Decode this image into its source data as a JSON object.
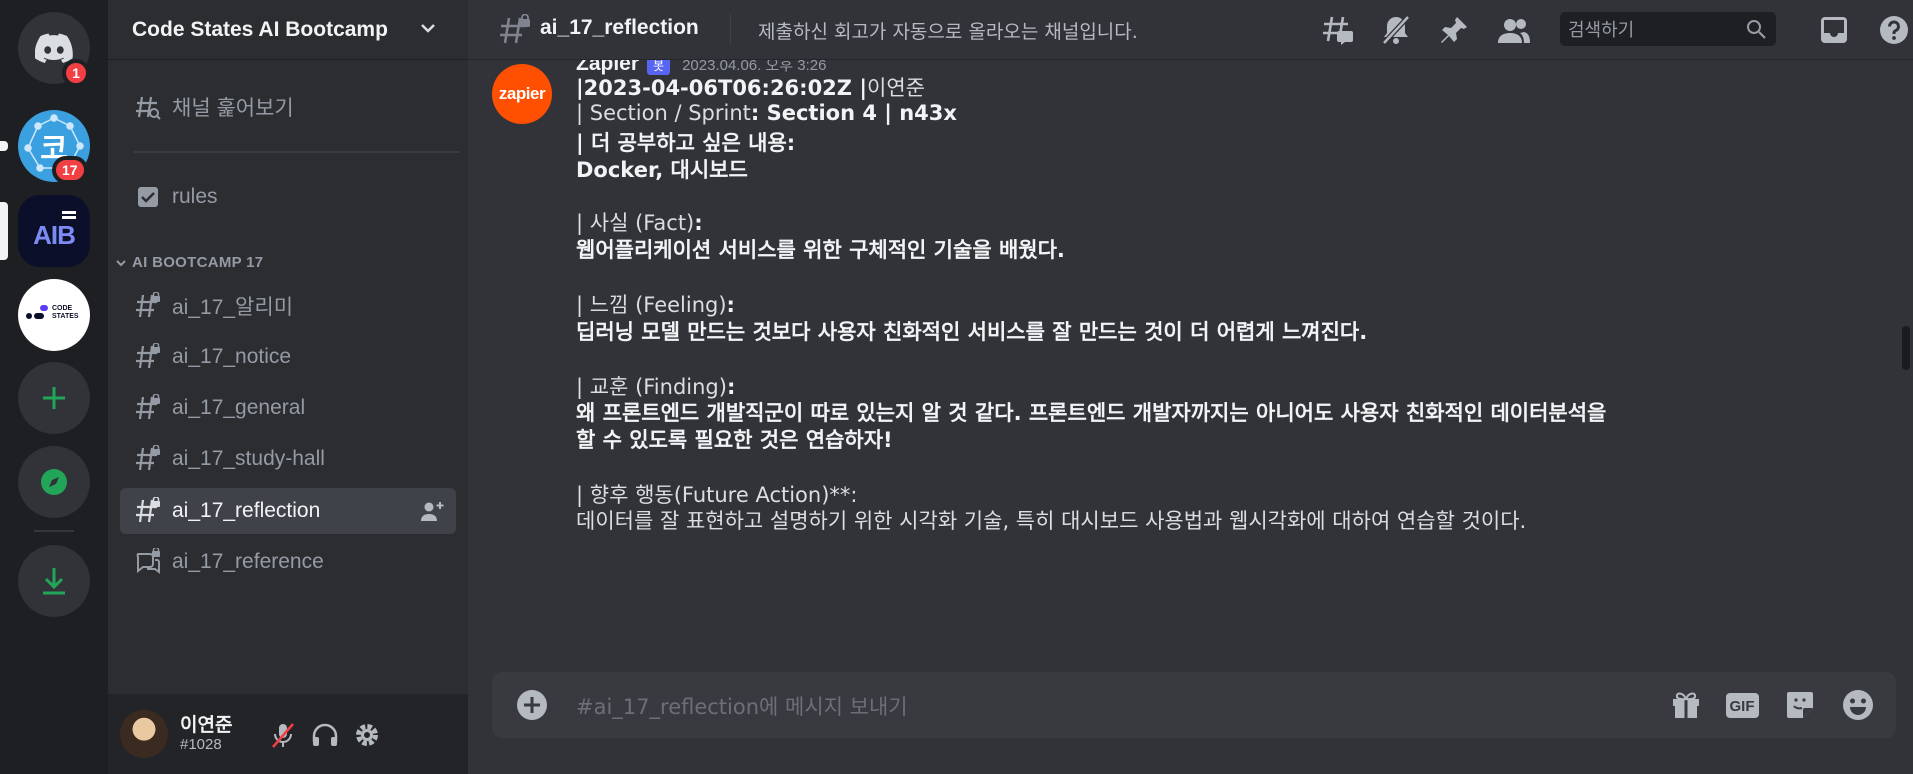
{
  "rail": {
    "home_badge": "1",
    "server1_glyph": "코",
    "server1_badge": "17",
    "server2_glyph": "AIB",
    "server3_glyph_line1": "CODE",
    "server3_glyph_line2": "STATES"
  },
  "guild": {
    "name": "Code States AI Bootcamp"
  },
  "sidebar": {
    "browse": "채널 훑어보기",
    "rules": "rules",
    "category": "AI BOOTCAMP 17",
    "channels": [
      {
        "label": "ai_17_알리미"
      },
      {
        "label": "ai_17_notice"
      },
      {
        "label": "ai_17_general"
      },
      {
        "label": "ai_17_study-hall"
      },
      {
        "label": "ai_17_reflection"
      },
      {
        "label": "ai_17_reference"
      }
    ]
  },
  "user": {
    "name": "이연준",
    "tag": "#1028"
  },
  "topbar": {
    "channel": "ai_17_reflection",
    "topic": "제출하신 회고가 자동으로 올라오는 채널입니다.",
    "search_placeholder": "검색하기"
  },
  "message": {
    "author": "Zapier",
    "avatar_text": "zapier",
    "bot_badge": "봇",
    "timestamp": "2023.04.06. 오후 3:26",
    "header_b": "|2023-04-06T06:26:02Z |",
    "header_rest": "이연준",
    "section_prefix": "| Section / Sprint",
    "section_bold": ": Section 4 | n43x",
    "study_label": "| 더 공부하고 싶은 내용:",
    "study_value": "Docker, 대시보드",
    "fact_label_a": "| 사실 (Fact)",
    "fact_label_b": ":",
    "fact_value": "웹어플리케이션 서비스를 위한 구체적인 기술을 배웠다.",
    "feeling_label_a": "| 느낌 (Feeling)",
    "feeling_label_b": ":",
    "feeling_value": "딥러닝 모델 만드는 것보다 사용자 친화적인 서비스를 잘 만드는 것이 더 어렵게 느껴진다.",
    "finding_label_a": "| 교훈 (Finding)",
    "finding_label_b": ":",
    "finding_value_1": "왜 프론트엔드 개발직군이 따로 있는지 알 것 같다. 프론트엔드 개발자까지는 아니어도 사용자 친화적인 데이터분석을",
    "finding_value_2": "할 수 있도록 필요한 것은 연습하자!",
    "action_label": "| 향후 행동(Future Action)**:",
    "action_value": "데이터를 잘 표현하고 설명하기 위한 시각화 기술, 특히 대시보드 사용법과 웹시각화에 대하여 연습할 것이다."
  },
  "composer": {
    "placeholder": "#ai_17_reflection에 메시지 보내기",
    "gif": "GIF"
  },
  "colors": {
    "accent": "#5865f2",
    "danger": "#f23f43",
    "green": "#23a559",
    "zapier": "#ff4f00"
  }
}
